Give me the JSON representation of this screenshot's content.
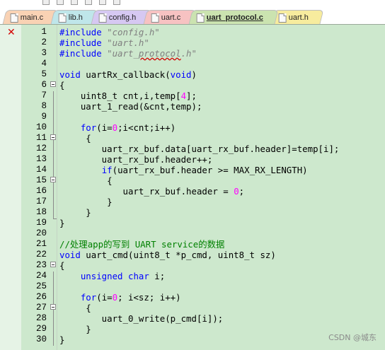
{
  "tabs": [
    {
      "label": "main.c"
    },
    {
      "label": "lib.h"
    },
    {
      "label": "config.h"
    },
    {
      "label": "uart.c"
    },
    {
      "label": "uart_protocol.c"
    },
    {
      "label": "uart.h"
    }
  ],
  "tab_colors": [
    "#f9d2b4",
    "#bfe6ea",
    "#d6c8f2",
    "#f7c2c2",
    "#cbe3b0",
    "#f7ec9e"
  ],
  "active_tab": "uart_protocol.c",
  "editor_background": "#cde8cd",
  "error_marker": "✕",
  "lines": [
    {
      "n": "1"
    },
    {
      "n": "2"
    },
    {
      "n": "3"
    },
    {
      "n": "4"
    },
    {
      "n": "5"
    },
    {
      "n": "6"
    },
    {
      "n": "7"
    },
    {
      "n": "8"
    },
    {
      "n": "9"
    },
    {
      "n": "10"
    },
    {
      "n": "11"
    },
    {
      "n": "12"
    },
    {
      "n": "13"
    },
    {
      "n": "14"
    },
    {
      "n": "15"
    },
    {
      "n": "16"
    },
    {
      "n": "17"
    },
    {
      "n": "18"
    },
    {
      "n": "19"
    },
    {
      "n": "20"
    },
    {
      "n": "21"
    },
    {
      "n": "22"
    },
    {
      "n": "23"
    },
    {
      "n": "24"
    },
    {
      "n": "25"
    },
    {
      "n": "26"
    },
    {
      "n": "27"
    },
    {
      "n": "28"
    },
    {
      "n": "29"
    },
    {
      "n": "30"
    }
  ],
  "code": {
    "l1_a": "#include ",
    "l1_b": "\"config.h\"",
    "l2_a": "#include ",
    "l2_b": "\"uart.h\"",
    "l3_a": "#include ",
    "l3_b1": "\"uart_",
    "l3_b2": "protocol",
    "l3_b3": ".h\"",
    "l5_a": "void",
    "l5_b": " uartRx_callback(",
    "l5_c": "void",
    "l5_d": ")",
    "l6": "{",
    "l7_a": "    uint8_t cnt,i,temp[",
    "l7_b": "4",
    "l7_c": "];",
    "l8": "    uart_1_read(&cnt,temp);",
    "l10_a": "    ",
    "l10_b": "for",
    "l10_c": "(i=",
    "l10_d": "0",
    "l10_e": ";i<cnt;i++)",
    "l11": "     {",
    "l12": "        uart_rx_buf.data[uart_rx_buf.header]=temp[i];",
    "l13": "        uart_rx_buf.header++;",
    "l14_a": "        ",
    "l14_b": "if",
    "l14_c": "(uart_rx_buf.header >= MAX_RX_LENGTH)",
    "l15": "         {",
    "l16_a": "            uart_rx_buf.header = ",
    "l16_b": "0",
    "l16_c": ";",
    "l17": "         }",
    "l18": "     }",
    "l19": "}",
    "l21": "//处理app的写到 UART service的数据",
    "l22_a": "void",
    "l22_b": " uart_cmd(uint8_t *p_cmd, uint8_t sz)",
    "l23": "{",
    "l24_a": "    ",
    "l24_b": "unsigned",
    "l24_c": " ",
    "l24_d": "char",
    "l24_e": " i;",
    "l26_a": "    ",
    "l26_b": "for",
    "l26_c": "(i=",
    "l26_d": "0",
    "l26_e": "; i<sz; i++)",
    "l27": "     {",
    "l28": "        uart_0_write(p_cmd[i]);",
    "l29": "     }",
    "l30": "}"
  },
  "watermark": "CSDN @城东"
}
